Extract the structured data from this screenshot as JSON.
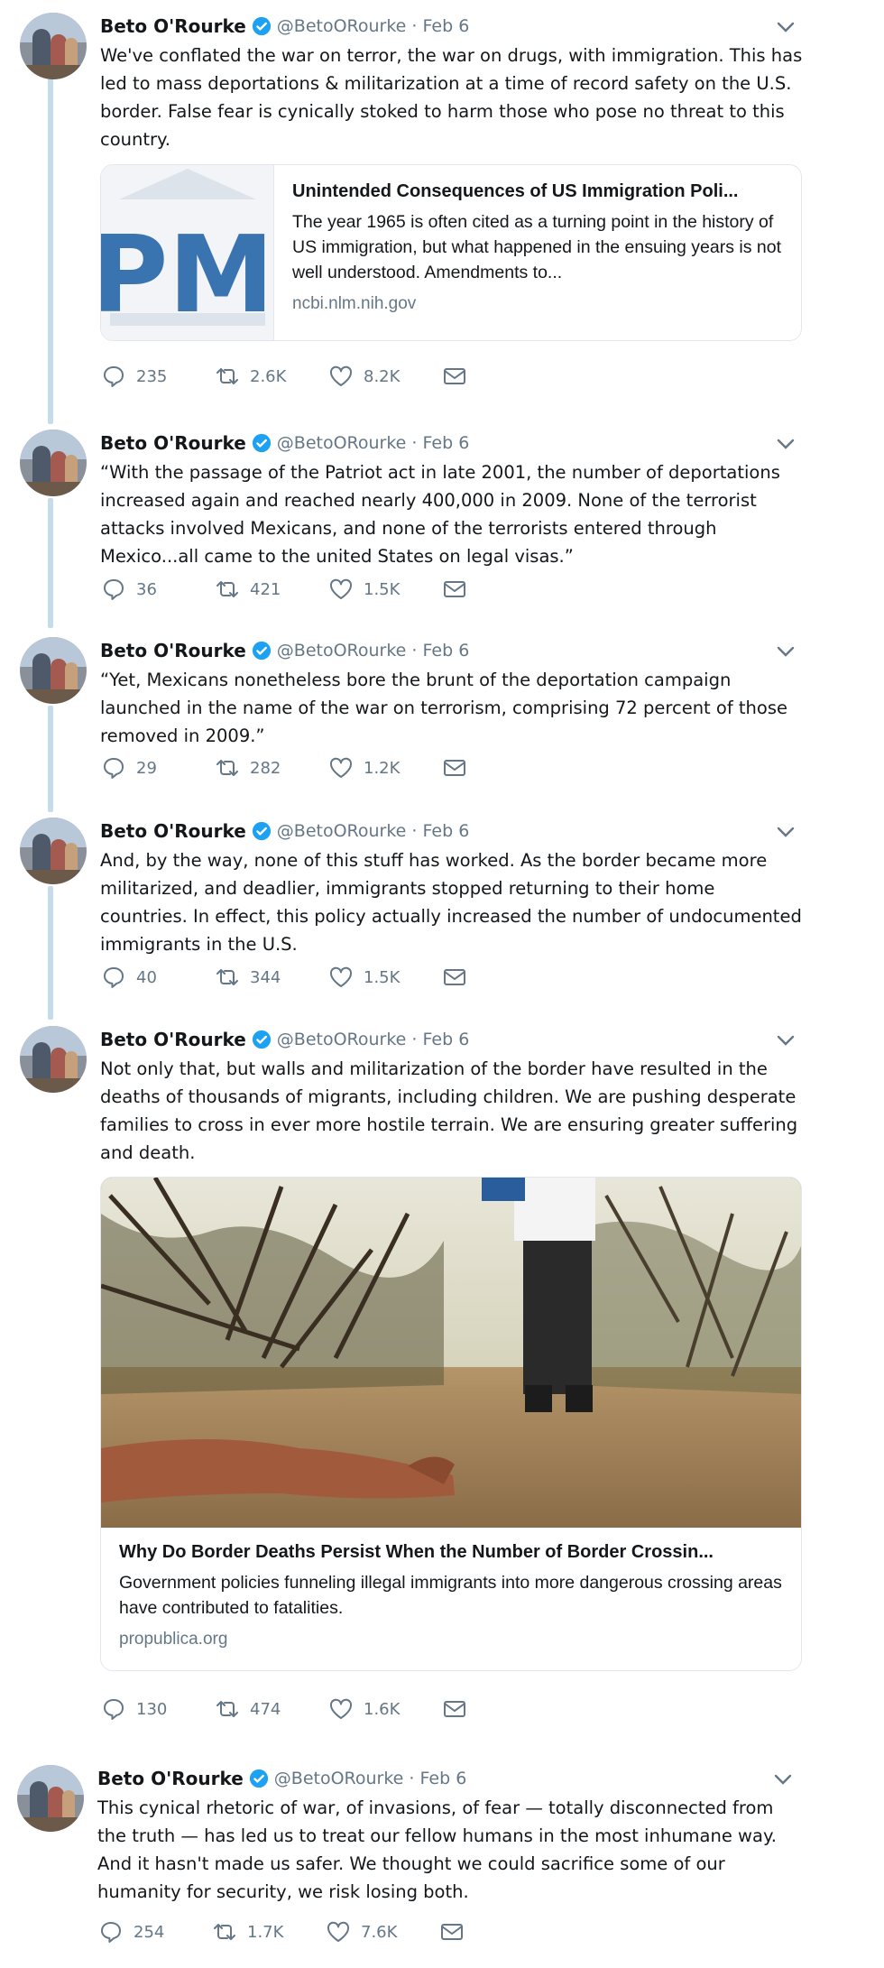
{
  "author": {
    "name": "Beto O'Rourke",
    "handle": "@BetoORourke",
    "date": "Feb 6"
  },
  "colors": {
    "verified": "#1da1f2",
    "icon_gray": "#657786",
    "thread_line": "#c4dceb"
  },
  "tweets": [
    {
      "text": "We've conflated the war on terror, the war on drugs, with immigration. This has led to mass deportations & militarization at a time of record safety on the U.S. border. False fear is cynically stoked to harm those who pose no threat to this country.",
      "card": {
        "title": "Unintended Consequences of US Immigration Poli...",
        "description": "The year 1965 is often cited as a turning point in the history of US immigration, but what happened in the ensuing years is not well understood. Amendments to...",
        "domain": "ncbi.nlm.nih.gov",
        "thumb_text": "PMC"
      },
      "stats": {
        "replies": "235",
        "retweets": "2.6K",
        "likes": "8.2K"
      }
    },
    {
      "text": "“With the passage of the Patriot act in late 2001, the number of deportations increased again and reached nearly 400,000 in 2009. None of the terrorist attacks involved Mexicans, and none of the terrorists entered through Mexico...all came to the united States on legal visas.”",
      "stats": {
        "replies": "36",
        "retweets": "421",
        "likes": "1.5K"
      }
    },
    {
      "text": "“Yet, Mexicans nonetheless bore the brunt of the deportation campaign launched in the name of the war on terrorism, comprising 72 percent of those removed in 2009.”",
      "stats": {
        "replies": "29",
        "retweets": "282",
        "likes": "1.2K"
      }
    },
    {
      "text": "And, by the way, none of this stuff has worked. As the border became more militarized, and deadlier, immigrants stopped returning to their home countries. In effect, this policy actually increased the number of undocumented immigrants in the U.S.",
      "stats": {
        "replies": "40",
        "retweets": "344",
        "likes": "1.5K"
      }
    },
    {
      "text": "Not only that, but walls and militarization of the border have resulted in the deaths of thousands of migrants, including children. We are pushing desperate families to cross in ever more hostile terrain. We are ensuring greater suffering and death.",
      "card": {
        "title": "Why Do Border Deaths Persist When the Number of Border Crossin...",
        "description": "Government policies funneling illegal immigrants into more dangerous crossing areas have contributed to fatalities.",
        "domain": "propublica.org"
      },
      "stats": {
        "replies": "130",
        "retweets": "474",
        "likes": "1.6K"
      }
    },
    {
      "text": "This cynical rhetoric of war, of invasions, of fear — totally disconnected from the truth — has led us to treat our fellow humans in the most inhumane way. And it hasn't made us safer. We thought we could sacrifice some of our humanity for security, we risk losing both.",
      "stats": {
        "replies": "254",
        "retweets": "1.7K",
        "likes": "7.6K"
      }
    }
  ]
}
